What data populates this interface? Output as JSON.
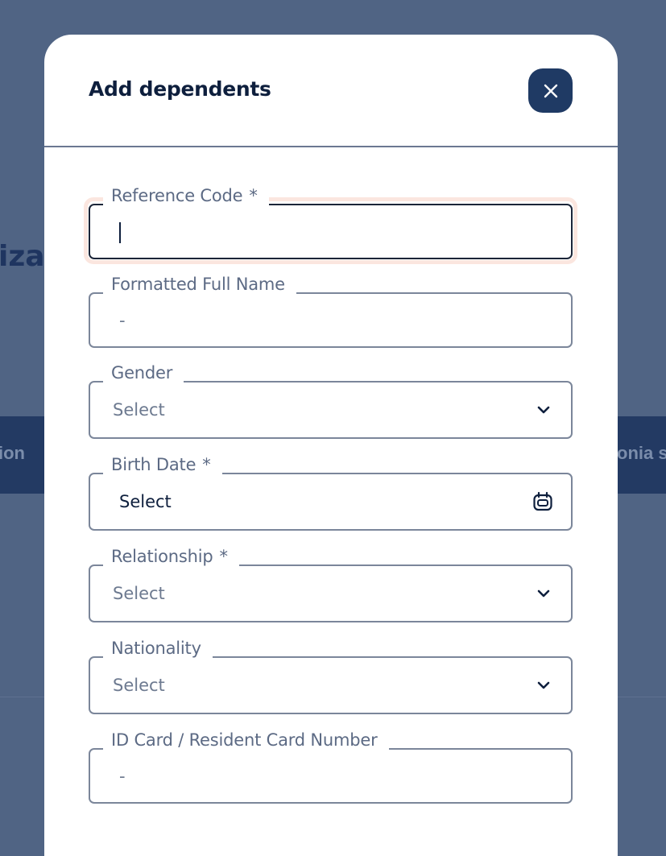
{
  "background": {
    "heading_fragment": "iza",
    "band_left_fragment": "ion",
    "band_right_fragment": "onia sp"
  },
  "modal": {
    "title": "Add dependents",
    "close_icon": "close-icon"
  },
  "fields": {
    "reference_code": {
      "label": "Reference Code",
      "required": "*",
      "value": ""
    },
    "formatted_full_name": {
      "label": "Formatted Full Name",
      "value": "-"
    },
    "gender": {
      "label": "Gender",
      "value": "Select",
      "icon": "chevron-down-icon"
    },
    "birth_date": {
      "label": "Birth Date",
      "required": "*",
      "value": "Select",
      "icon": "calendar-icon"
    },
    "relationship": {
      "label": "Relationship",
      "required": "*",
      "value": "Select",
      "icon": "chevron-down-icon"
    },
    "nationality": {
      "label": "Nationality",
      "value": "Select",
      "icon": "chevron-down-icon"
    },
    "id_card_number": {
      "label": "ID Card / Resident Card Number",
      "value": "-"
    }
  },
  "colors": {
    "overlay": "#506484",
    "accent": "#1f3a64",
    "title": "#0e1f3d",
    "label": "#5c6a84",
    "focus_ring": "#fbe6df"
  }
}
